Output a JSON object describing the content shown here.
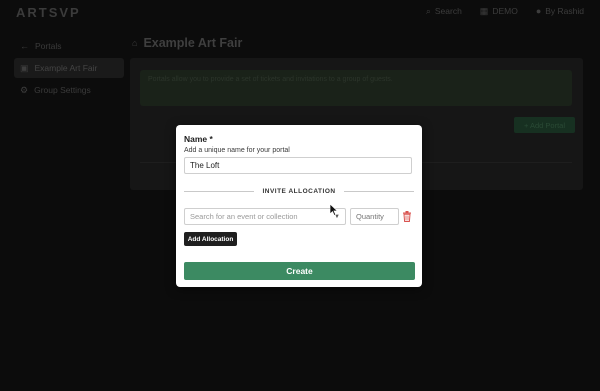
{
  "app": {
    "logo": "ARTSVP"
  },
  "topnav": {
    "search": "Search",
    "demo": "DEMO",
    "user": "By Rashid"
  },
  "sidebar": {
    "items": [
      {
        "label": "Portals",
        "icon": "back-arrow-icon"
      },
      {
        "label": "Example Art Fair",
        "icon": "building-icon",
        "active": true
      },
      {
        "label": "Group Settings",
        "icon": "gear-icon"
      }
    ]
  },
  "page": {
    "title": "Example Art Fair",
    "info": "Portals allow you to provide a set of tickets and invitations to a group of guests.",
    "add_portal": "+ Add Portal"
  },
  "modal": {
    "name_label": "Name *",
    "name_help": "Add a unique name for your portal",
    "name_value": "The Loft",
    "section_title": "INVITE ALLOCATION",
    "search_placeholder": "Search for an event or collection",
    "quantity_placeholder": "Quantity",
    "add_allocation": "Add Allocation",
    "create": "Create"
  },
  "colors": {
    "primary_green": "#3c8a62",
    "dark_button": "#1f1f1f",
    "delete_red": "#d9534f"
  }
}
